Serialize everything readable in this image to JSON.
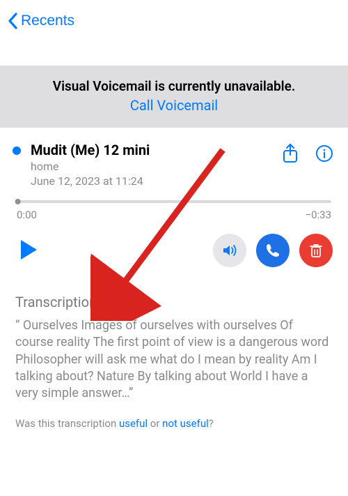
{
  "nav": {
    "back_label": "Recents"
  },
  "banner": {
    "title": "Visual Voicemail is currently unavailable.",
    "link": "Call Voicemail"
  },
  "voicemail": {
    "caller": "Mudit (Me) 12 mini",
    "label": "home",
    "date": "June 12, 2023 at 11:24",
    "elapsed": "0:00",
    "remaining": "−0:33"
  },
  "transcription": {
    "heading": "Transcription",
    "body": "“ Ourselves Images of ourselves with ourselves Of course reality The first point of view is a dangerous word Philosopher will ask me what do I mean by reality Am I talking about? Nature By talking about World I have a very simple answer…”"
  },
  "feedback": {
    "prompt_prefix": "Was this transcription ",
    "useful": "useful",
    "or": " or ",
    "not_useful": "not useful",
    "suffix": "?"
  }
}
